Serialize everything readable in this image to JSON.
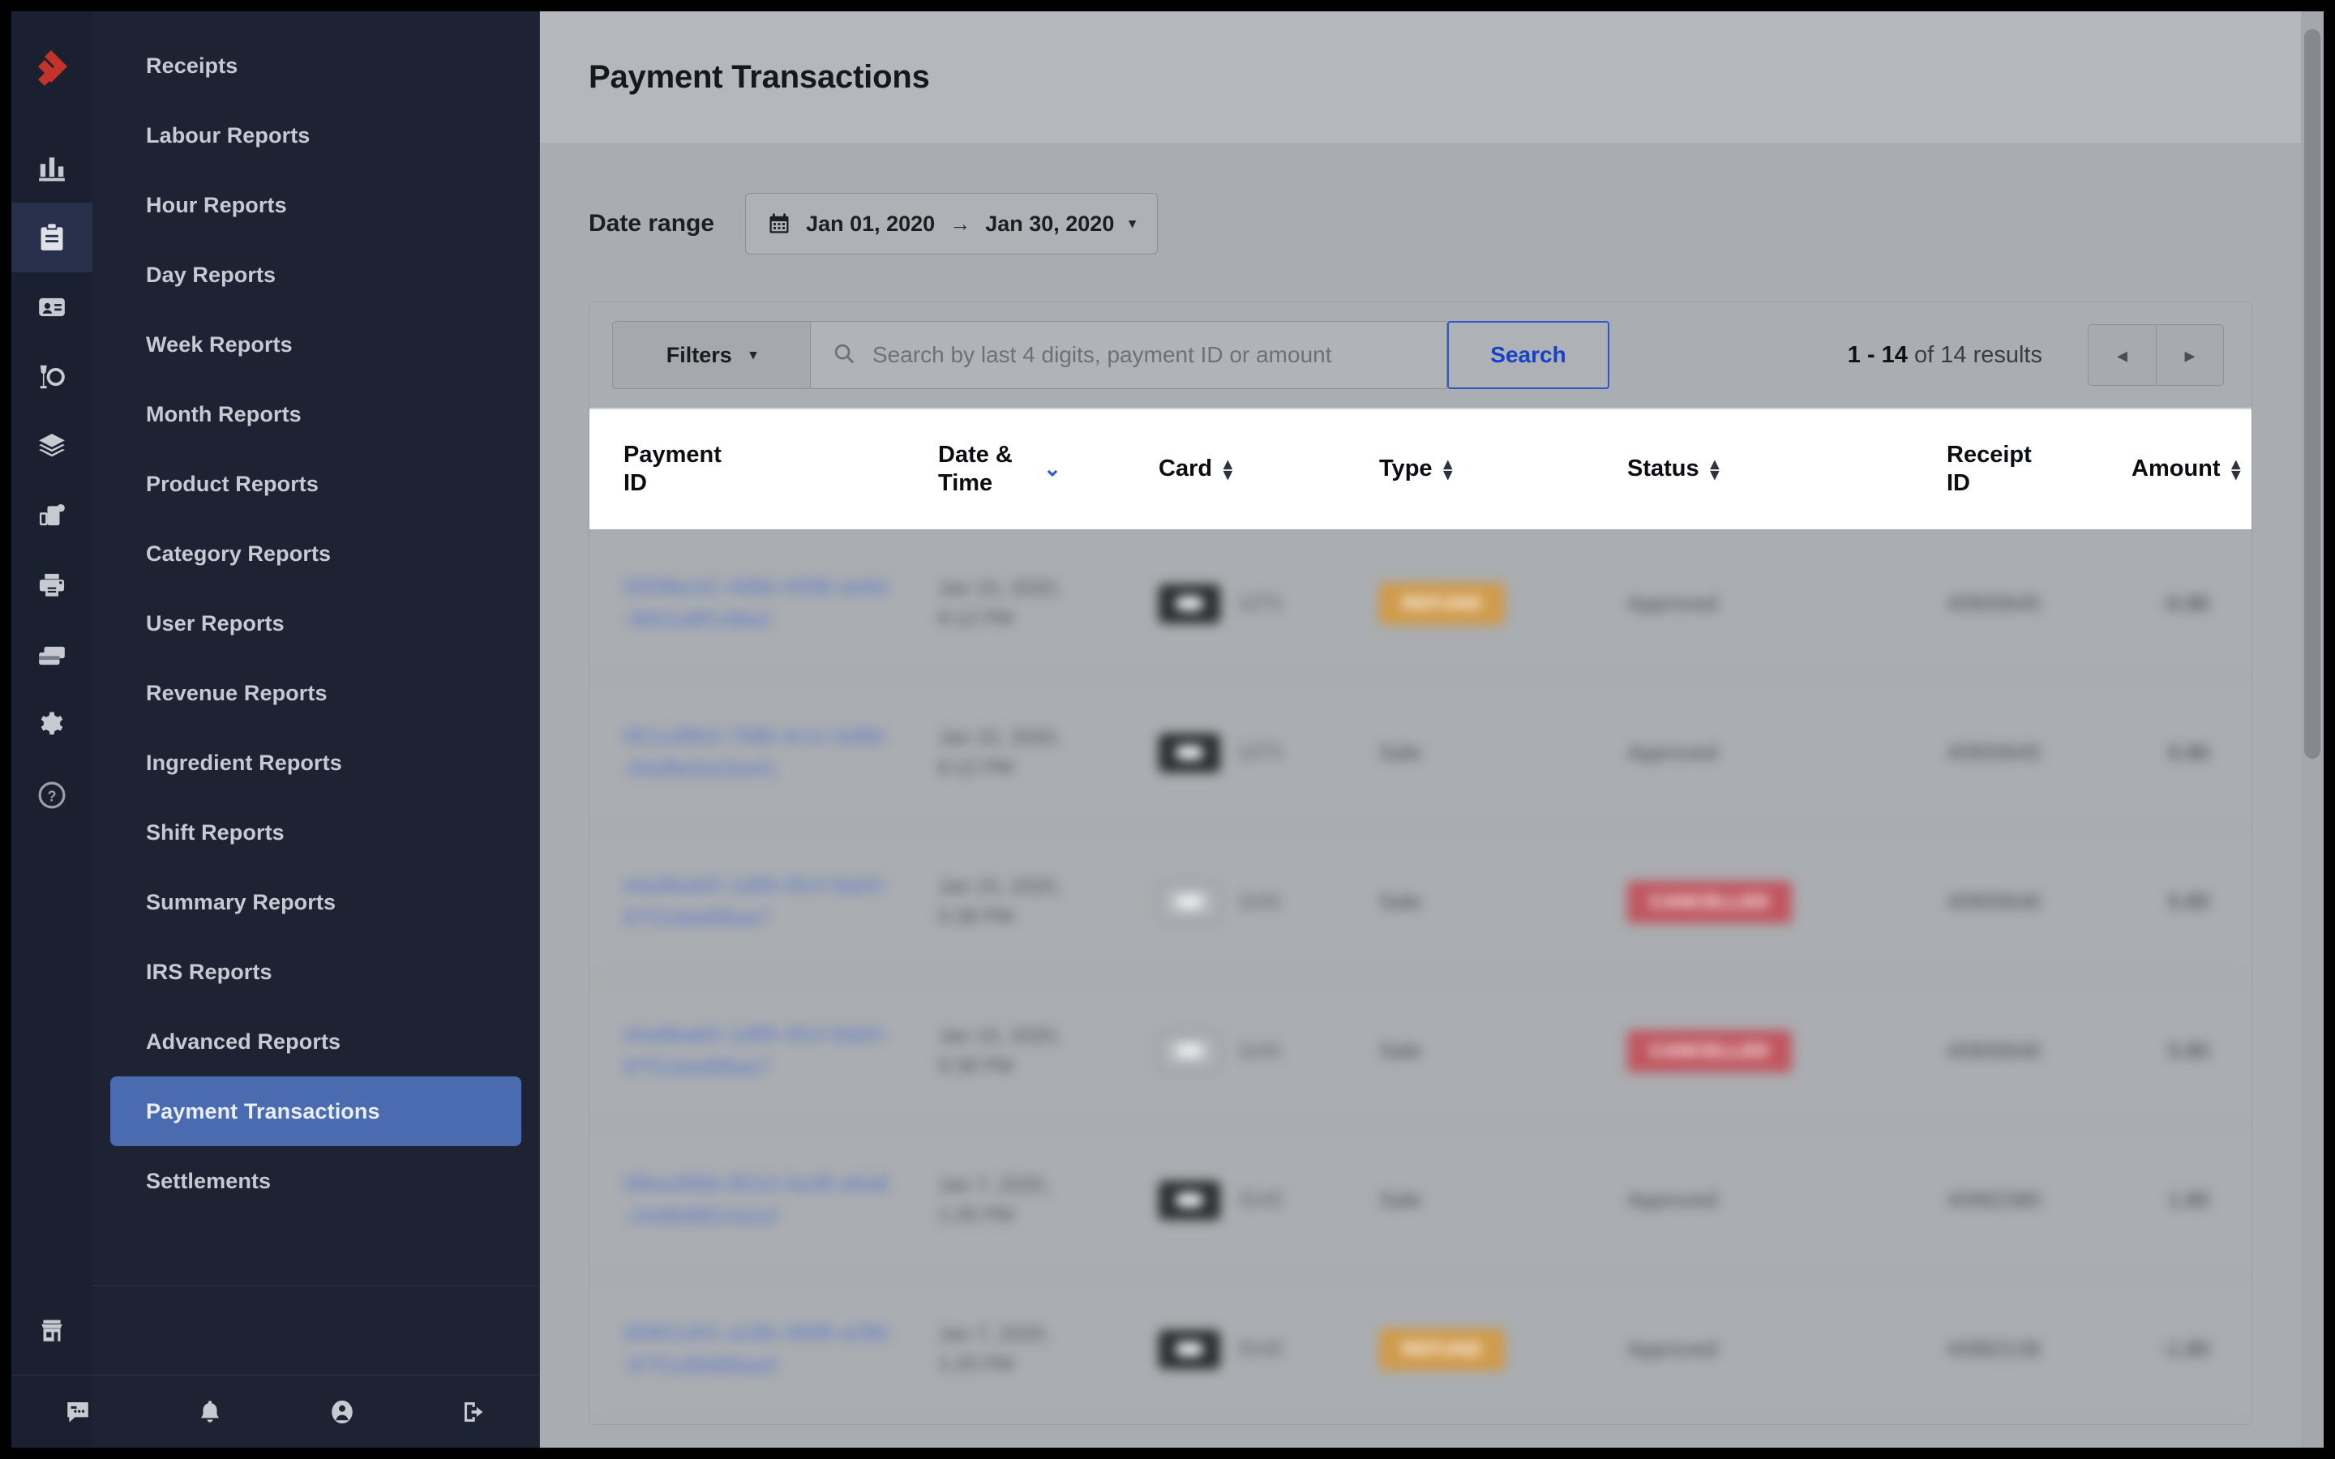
{
  "app": {
    "brand_color": "#C4332A",
    "accent_blue": "#2a5ad9",
    "logo_name": "lightspeed-flame-logo"
  },
  "icon_rail": {
    "items": [
      {
        "name": "bar-chart-icon",
        "label": "Analytics"
      },
      {
        "name": "clipboard-icon",
        "label": "Reports",
        "active": true
      },
      {
        "name": "id-card-icon",
        "label": "Customers"
      },
      {
        "name": "glass-plate-icon",
        "label": "Menu"
      },
      {
        "name": "layers-icon",
        "label": "Inventory"
      },
      {
        "name": "devices-icon",
        "label": "Devices"
      },
      {
        "name": "printer-icon",
        "label": "Printers"
      },
      {
        "name": "cards-icon",
        "label": "Payments"
      },
      {
        "name": "gear-icon",
        "label": "Settings"
      },
      {
        "name": "help-icon",
        "label": "Help"
      }
    ]
  },
  "sidebar": {
    "items": [
      {
        "label": "Receipts"
      },
      {
        "label": "Labour Reports"
      },
      {
        "label": "Hour Reports"
      },
      {
        "label": "Day Reports"
      },
      {
        "label": "Week Reports"
      },
      {
        "label": "Month Reports"
      },
      {
        "label": "Product Reports"
      },
      {
        "label": "Category Reports"
      },
      {
        "label": "User Reports"
      },
      {
        "label": "Revenue Reports"
      },
      {
        "label": "Ingredient Reports"
      },
      {
        "label": "Shift Reports"
      },
      {
        "label": "Summary Reports"
      },
      {
        "label": "IRS Reports"
      },
      {
        "label": "Advanced Reports"
      },
      {
        "label": "Payment Transactions",
        "selected": true
      },
      {
        "label": "Settlements"
      }
    ],
    "store_icon": "store-icon",
    "bottom_icons": [
      {
        "name": "chat-icon"
      },
      {
        "name": "bell-icon"
      },
      {
        "name": "account-icon"
      },
      {
        "name": "logout-icon"
      }
    ]
  },
  "header": {
    "title": "Payment Transactions"
  },
  "date_range": {
    "label": "Date range",
    "calendar_icon": "calendar-icon",
    "start": "Jan 01, 2020",
    "separator": "→",
    "end": "Jan 30, 2020",
    "caret": "▾"
  },
  "toolbar": {
    "filters_label": "Filters",
    "filters_caret": "▾",
    "search_icon": "search-icon",
    "search_placeholder": "Search by last 4 digits, payment ID or amount",
    "search_value": "",
    "search_button_label": "Search",
    "results_range": "1 - 14",
    "results_suffix": "of 14 results",
    "prev_label": "◂",
    "next_label": "▸"
  },
  "table": {
    "columns": [
      {
        "key": "payment_id",
        "label": "Payment ID",
        "sortable": false
      },
      {
        "key": "date_time",
        "label": "Date & Time",
        "sortable": true,
        "sorted": "desc"
      },
      {
        "key": "card",
        "label": "Card",
        "sortable": true
      },
      {
        "key": "type",
        "label": "Type",
        "sortable": true
      },
      {
        "key": "status",
        "label": "Status",
        "sortable": true
      },
      {
        "key": "receipt_id",
        "label": "Receipt ID",
        "sortable": false
      },
      {
        "key": "amount",
        "label": "Amount",
        "sortable": true
      }
    ],
    "rows": [
      {
        "payment_id": "0008bcd1-4d8d-4698-ad4d-8601d8f148a2",
        "date_time": "Jan 15, 2020, 6:12 PM",
        "card_brand": "dark",
        "card_digits": "1271",
        "type": "REFUND",
        "type_kind": "badge-refund",
        "status": "Approved",
        "receipt_id": "40900645",
        "amount": "-6.86"
      },
      {
        "payment_id": "001cd9b3-7586-4c1c-bd8e-84d8e0a1ba41",
        "date_time": "Jan 15, 2020, 6:12 PM",
        "card_brand": "dark",
        "card_digits": "1271",
        "type": "Sale",
        "type_kind": "text",
        "status": "Approved",
        "receipt_id": "40900645",
        "amount": "6.86"
      },
      {
        "payment_id": "eba8bab5-1d89-45cf-8ab5-8751dad88aa7",
        "date_time": "Jan 15, 2020, 5:38 PM",
        "card_brand": "light",
        "card_digits": "1141",
        "type": "Sale",
        "type_kind": "text",
        "status": "CANCELLED",
        "status_kind": "badge-cancelled",
        "receipt_id": "40900646",
        "amount": "5.80"
      },
      {
        "payment_id": "eba8bab5-1d89-45cf-8ab5-8751dad88aa7",
        "date_time": "Jan 15, 2020, 5:38 PM",
        "card_brand": "light",
        "card_digits": "1141",
        "type": "Sale",
        "type_kind": "text",
        "status": "CANCELLED",
        "status_kind": "badge-cancelled",
        "receipt_id": "40900646",
        "amount": "5.80"
      },
      {
        "payment_id": "08ea30bb-801d-4a38-a6a8-24d8d8810a1d",
        "date_time": "Jan 7, 2020, 1:26 PM",
        "card_brand": "dark",
        "card_digits": "3142",
        "type": "Sale",
        "type_kind": "text",
        "status": "Approved",
        "receipt_id": "40982380",
        "amount": "1.80"
      },
      {
        "payment_id": "d0901d41-a18b-4898-a28b-8751d8d88aa3",
        "date_time": "Jan 7, 2020, 1:25 PM",
        "card_brand": "dark",
        "card_digits": "3142",
        "type": "REFUND",
        "type_kind": "badge-refund",
        "status": "Approved",
        "receipt_id": "40982138",
        "amount": "-1.80"
      }
    ]
  }
}
